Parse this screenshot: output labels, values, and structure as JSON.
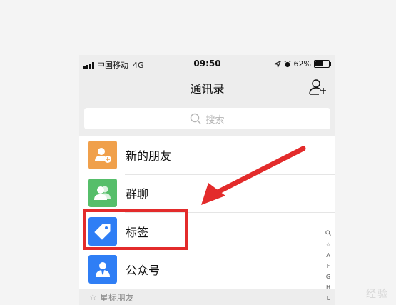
{
  "status_bar": {
    "carrier": "中国移动",
    "network": "4G",
    "time": "09:50",
    "battery": "62%",
    "battery_level": 0.62
  },
  "nav": {
    "title": "通讯录",
    "add_icon": "add-contact-icon"
  },
  "search": {
    "placeholder": "搜索",
    "icon": "search-icon"
  },
  "contacts_menu": [
    {
      "label": "新的朋友",
      "icon": "new-friend-icon",
      "color": "#f0a04b"
    },
    {
      "label": "群聊",
      "icon": "group-chat-icon",
      "color": "#56be6a"
    },
    {
      "label": "标签",
      "icon": "tag-icon",
      "color": "#2f7ef5"
    },
    {
      "label": "公众号",
      "icon": "official-account-icon",
      "color": "#2f7ef5"
    }
  ],
  "section_header": {
    "label": "星标朋友",
    "icon": "star-icon"
  },
  "index_bar": [
    "Q",
    "☆",
    "A",
    "F",
    "G",
    "H",
    "L"
  ],
  "annotation": {
    "highlight_color": "#e32b2b"
  },
  "watermark": "经验"
}
